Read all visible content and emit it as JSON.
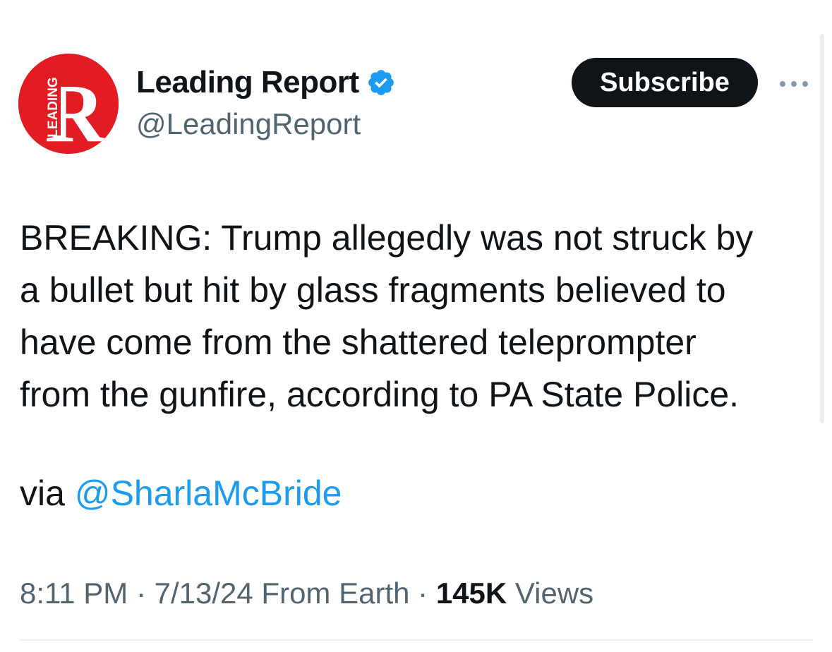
{
  "author": {
    "display_name": "Leading Report",
    "handle": "@LeadingReport",
    "avatar": {
      "letter": "R",
      "vertical_text": "LEADING",
      "bg_color": "#e31b23",
      "fg_color": "#ffffff"
    },
    "verified_icon": "verified-badge-icon",
    "verified_color": "#1d9bf0"
  },
  "actions": {
    "subscribe_label": "Subscribe",
    "more_icon": "more-horizontal-icon"
  },
  "tweet": {
    "text_lines": [
      "BREAKING: Trump allegedly was not struck by",
      "a bullet but hit by glass fragments believed to",
      "have come from the shattered teleprompter",
      "from the gunfire, according to PA State Police."
    ],
    "via_prefix": "via ",
    "via_mention": "@SharlaMcBride"
  },
  "meta": {
    "time": "8:11 PM",
    "separator": " · ",
    "date": "7/13/24",
    "source": " From Earth",
    "separator2": " · ",
    "views_count": "145K",
    "views_label": " Views"
  },
  "colors": {
    "text": "#0f1419",
    "secondary": "#536471",
    "link": "#1d9bf0",
    "button_bg": "#0f1419"
  }
}
